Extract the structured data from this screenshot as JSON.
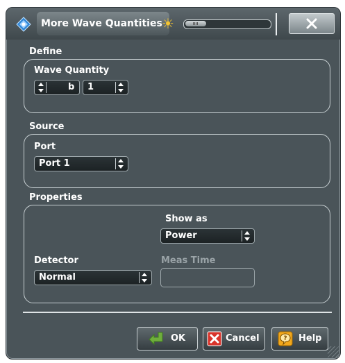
{
  "window": {
    "title": "More Wave Quantities"
  },
  "define": {
    "label": "Define",
    "wave_quantity_label": "Wave Quantity",
    "wave_value": "b",
    "port_value": "1"
  },
  "source": {
    "label": "Source",
    "port_label": "Port",
    "port_value": "Port 1"
  },
  "properties": {
    "label": "Properties",
    "show_as_label": "Show as",
    "show_as_value": "Power",
    "detector_label": "Detector",
    "detector_value": "Normal",
    "meas_time_label": "Meas Time",
    "meas_time_value": ""
  },
  "buttons": {
    "ok": "OK",
    "cancel": "Cancel",
    "help": "Help"
  },
  "colors": {
    "background": "#4a5459",
    "border": "#c8d0d3",
    "text": "#ffffff",
    "disabled_text": "#9aa3a7",
    "sun": "#f4c430",
    "cancel_red": "#d9342b",
    "help_orange": "#f2a81d",
    "ok_green": "#6fae3c"
  },
  "icons": {
    "title": "window-diamond-icon",
    "brightness": "sun-icon",
    "close": "close-x-icon",
    "ok": "ok-check-arrow-icon",
    "cancel": "cancel-x-icon",
    "help": "help-question-icon"
  }
}
